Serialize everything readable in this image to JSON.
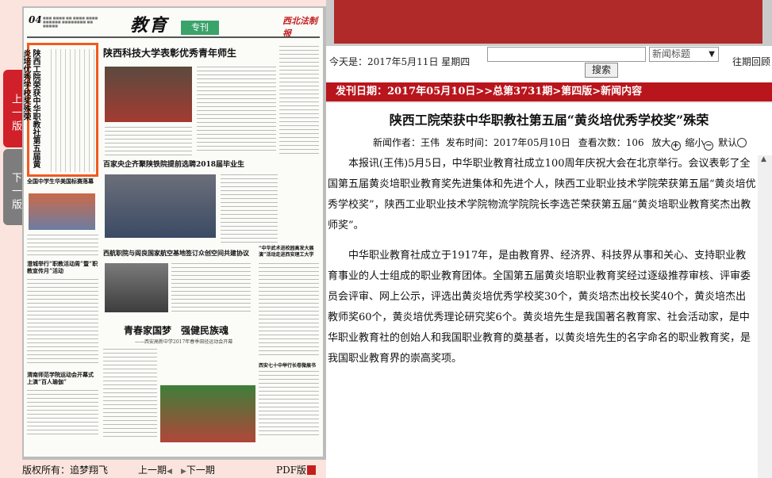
{
  "left_pane": {
    "prev_tab_label": "上一版",
    "next_tab_label": "下一版",
    "newspaper": {
      "page_number": "04",
      "masthead": "教育",
      "masthead_sub": "专刊",
      "paper_name": "西北法制报",
      "highlight_headline": "陕西工院荣获中华职教社第五届黄炎培优秀学校奖殊荣",
      "headline_1": "陕西科技大学表彰优秀青年师生",
      "headline_2": "百家央企齐聚陕铁院提前选聘2018届毕业生",
      "headline_3": "西航职院与阎良国家航空基地签订众创空间共建协议",
      "headline_4": "青春家国梦　强健民族魂",
      "subheadline_4": "——西安高新中学2017年春季田径运动会开幕",
      "side_headline_1": "全国中学生华美国标赛落幕",
      "side_headline_2": "澄城举行“职教活动周”暨“职教宣传月”活动",
      "side_headline_3": "渭南师范学院运动会开幕式上演“百人瑜伽”",
      "side_headline_4": "“中华武术进校园高发大展演”活动走进西安理工大学",
      "side_headline_5": "西安七十中举行长卷微展书"
    },
    "bottom": {
      "copyright": "版权所有：追梦翔飞",
      "prev_issue": "上一期",
      "next_issue": "下一期",
      "pdf": "PDF版"
    }
  },
  "right_pane": {
    "today_label": "今天是：2017年5月11日 星期四",
    "search_placeholder": "",
    "search_select_value": "新闻标题",
    "search_button": "搜索",
    "past_review": "往期回顾",
    "breadcrumb": "发刊日期：2017年05月10日>>总第3731期>第四版>新闻内容",
    "article": {
      "title": "陕西工院荣获中华职教社第五届“黄炎培优秀学校奖”殊荣",
      "author_label": "新闻作者：王伟",
      "publish_label": "发布时间：2017年05月10日",
      "views_label": "查看次数：106",
      "zoom_in": "放大",
      "zoom_out": "缩小",
      "default": "默认",
      "paragraph_1": "本报讯(王伟)5月5日，中华职业教育社成立100周年庆祝大会在北京举行。会议表彰了全国第五届黄炎培职业教育奖先进集体和先进个人，陕西工业职业技术学院荣获第五届“黄炎培优秀学校奖”，陕西工业职业技术学院物流学院院长李选芒荣获第五届“黄炎培职业教育奖杰出教师奖”。",
      "paragraph_2": "中华职业教育社成立于1917年，是由教育界、经济界、科技界从事和关心、支持职业教育事业的人士组成的职业教育团体。全国第五届黄炎培职业教育奖经过逐级推荐审核、评审委员会评审、网上公示，评选出黄炎培优秀学校奖30个，黄炎培杰出校长奖40个，黄炎培杰出教师奖60个，黄炎培优秀理论研究奖6个。黄炎培先生是我国著名教育家、社会活动家，是中华职业教育社的创始人和我国职业教育的奠基者，以黄炎培先生的名字命名的职业教育奖，是我国职业教育界的崇高奖项。"
    }
  }
}
